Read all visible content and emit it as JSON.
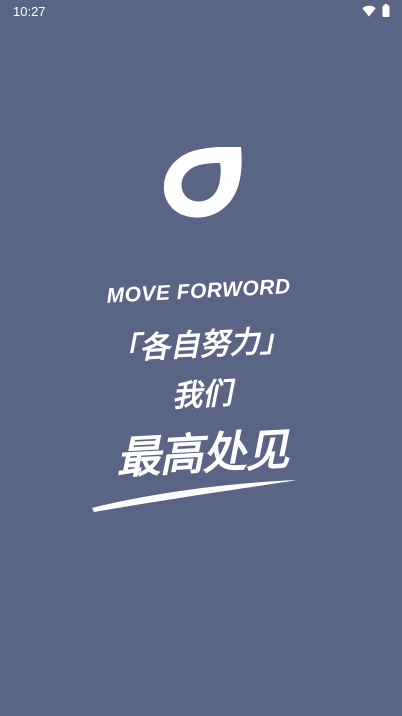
{
  "status_bar": {
    "time": "10:27",
    "icons": [
      "wifi-icon",
      "battery-icon"
    ]
  },
  "splash": {
    "logo_icon": "leaf-drop-logo-icon",
    "slogan_en": "MOVE FORWORD",
    "slogan_line1": "「各自努力」",
    "slogan_line2": "我们",
    "slogan_line3": "最高处见"
  },
  "colors": {
    "background": "#5a6585",
    "foreground": "#ffffff"
  }
}
